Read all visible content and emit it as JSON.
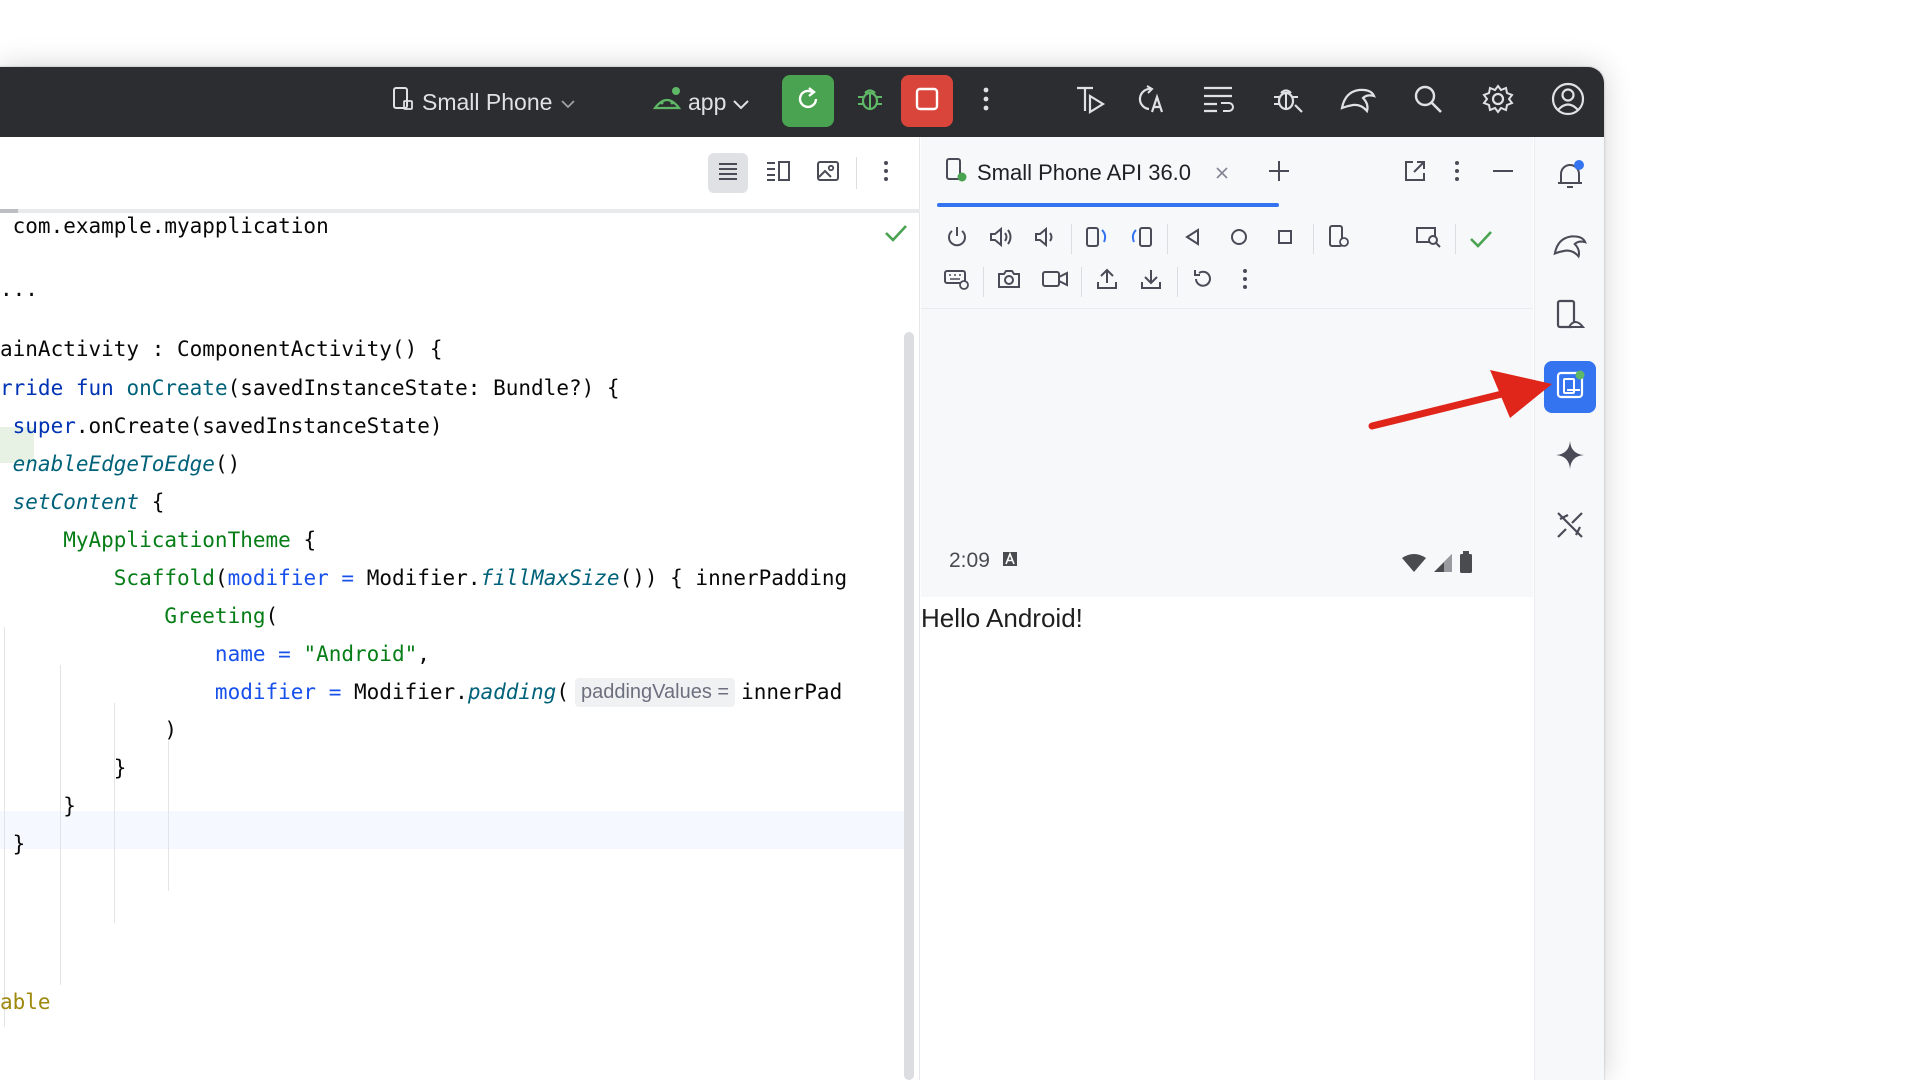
{
  "titlebar": {
    "device_label": "Small Phone",
    "app_label": "app"
  },
  "editor": {
    "lines": [
      {
        "parts": [
          {
            "t": " com.example.myapplication",
            "c": ""
          }
        ]
      },
      {
        "parts": [
          {
            "t": "...",
            "c": ""
          }
        ]
      },
      {
        "parts": [
          {
            "t": "ainActivity : ComponentActivity() {",
            "c": ""
          }
        ]
      },
      {
        "parts": [
          {
            "t": "rride ",
            "c": "kw"
          },
          {
            "t": "fun ",
            "c": "kw"
          },
          {
            "t": "onCreate",
            "c": "fn"
          },
          {
            "t": "(savedInstanceState: Bundle?) {",
            "c": ""
          }
        ]
      },
      {
        "parts": [
          {
            "t": " super",
            "c": "kw"
          },
          {
            "t": ".onCreate(savedInstanceState)",
            "c": ""
          }
        ]
      },
      {
        "parts": [
          {
            "t": " enableEdgeToEdge",
            "c": "it"
          },
          {
            "t": "()",
            "c": ""
          }
        ]
      },
      {
        "parts": [
          {
            "t": " setContent",
            "c": "it"
          },
          {
            "t": " {",
            "c": ""
          }
        ]
      },
      {
        "parts": [
          {
            "t": "     MyApplicationTheme",
            "c": "cls"
          },
          {
            "t": " {",
            "c": ""
          }
        ]
      },
      {
        "parts": [
          {
            "t": "         Scaffold",
            "c": "cls"
          },
          {
            "t": "(",
            "c": ""
          },
          {
            "t": "modifier",
            "c": "prm"
          },
          {
            "t": " = ",
            "c": "prm"
          },
          {
            "t": "Modifier.",
            "c": ""
          },
          {
            "t": "fillMaxSize",
            "c": "it"
          },
          {
            "t": "()) { innerPadding",
            "c": ""
          }
        ]
      },
      {
        "parts": [
          {
            "t": "             Greeting",
            "c": "cls"
          },
          {
            "t": "(",
            "c": ""
          }
        ]
      },
      {
        "parts": [
          {
            "t": "                 name",
            "c": "prm"
          },
          {
            "t": " = ",
            "c": "prm"
          },
          {
            "t": "\"Android\"",
            "c": "str"
          },
          {
            "t": ",",
            "c": ""
          }
        ]
      },
      {
        "parts": [
          {
            "t": "                 modifier",
            "c": "prm"
          },
          {
            "t": " = ",
            "c": "prm"
          },
          {
            "t": "Modifier.",
            "c": ""
          },
          {
            "t": "padding",
            "c": "it"
          },
          {
            "t": "(",
            "c": ""
          },
          {
            "t": "paddingValues =",
            "c": "hint"
          },
          {
            "t": "innerPad",
            "c": ""
          }
        ]
      },
      {
        "parts": [
          {
            "t": "             )",
            "c": ""
          }
        ]
      },
      {
        "parts": [
          {
            "t": "         }",
            "c": ""
          }
        ]
      },
      {
        "parts": [
          {
            "t": "     }",
            "c": ""
          }
        ]
      },
      {
        "parts": [
          {
            "t": " }",
            "c": ""
          }
        ]
      },
      {
        "parts": [
          {
            "t": "able",
            "c": "ann"
          }
        ]
      }
    ]
  },
  "emulator": {
    "tab_label": "Small Phone API 36.0",
    "status_time": "2:09",
    "hello_text": "Hello Android!"
  },
  "colors": {
    "titlebar_bg": "#2b2d30",
    "run_green": "#4aa350",
    "stop_red": "#d9453b",
    "accent_blue": "#3574f0",
    "annotation_arrow": "#e0261b"
  }
}
